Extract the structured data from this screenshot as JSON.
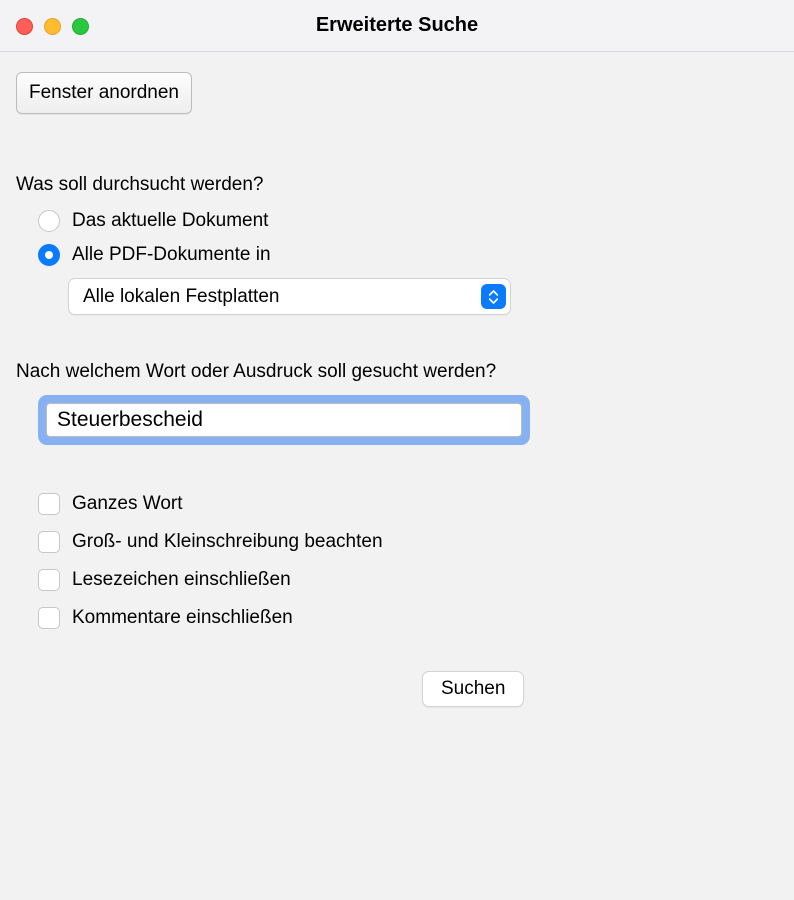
{
  "window": {
    "title": "Erweiterte Suche"
  },
  "toolbar": {
    "arrange_windows_label": "Fenster anordnen"
  },
  "search_scope": {
    "heading": "Was soll durchsucht werden?",
    "option_current_doc": "Das aktuelle Dokument",
    "option_all_pdfs_in": "Alle PDF-Dokumente in",
    "selected_option": "all_pdfs",
    "location_select": {
      "selected_label": "Alle lokalen Festplatten"
    }
  },
  "search_term": {
    "heading": "Nach welchem Wort oder Ausdruck soll gesucht werden?",
    "value": "Steuerbescheid"
  },
  "options": {
    "whole_word": "Ganzes Wort",
    "case_sensitive": "Groß- und Kleinschreibung beachten",
    "include_bookmarks": "Lesezeichen einschließen",
    "include_comments": "Kommentare einschließen"
  },
  "actions": {
    "search_label": "Suchen"
  }
}
